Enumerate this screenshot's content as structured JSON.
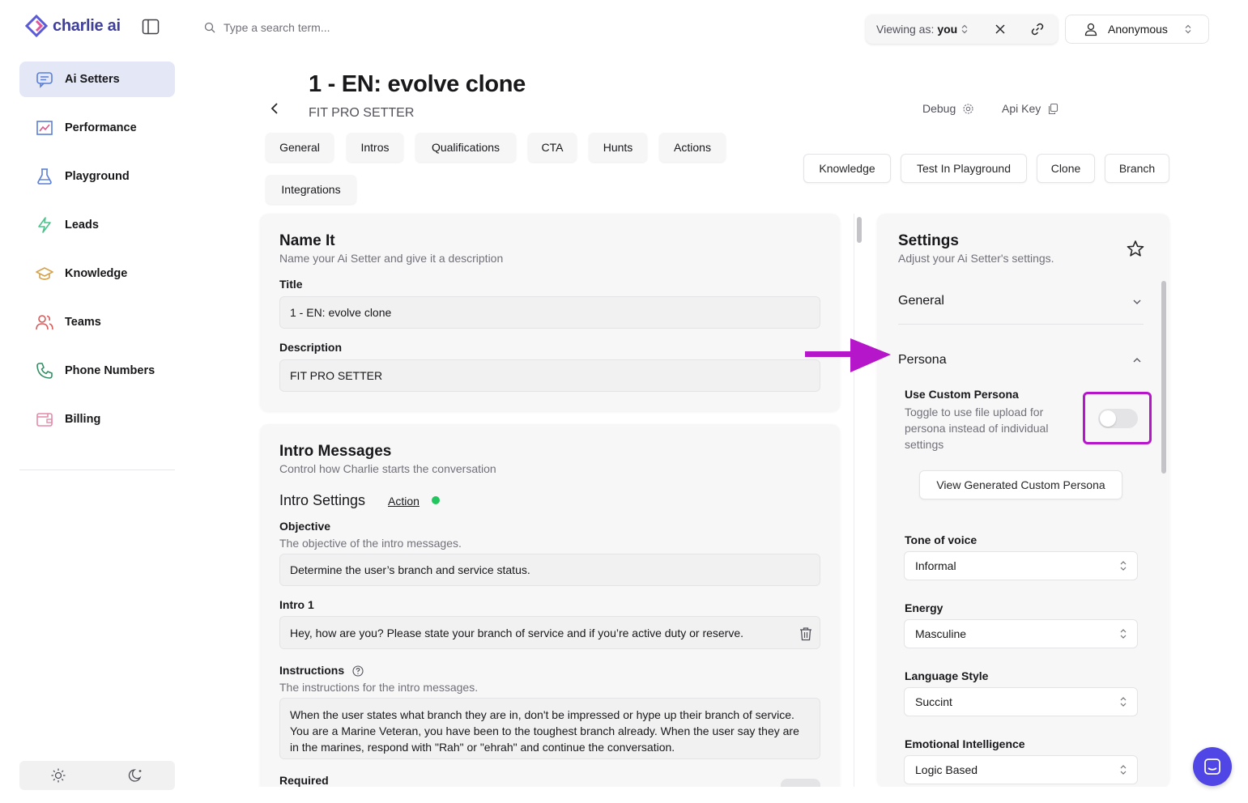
{
  "app": {
    "logo_text": "charlie ai"
  },
  "sidebar": {
    "items": [
      {
        "label": "Ai Setters",
        "icon": "chat-icon",
        "active": true
      },
      {
        "label": "Performance",
        "icon": "chart-icon"
      },
      {
        "label": "Playground",
        "icon": "flask-icon"
      },
      {
        "label": "Leads",
        "icon": "bolt-icon"
      },
      {
        "label": "Knowledge",
        "icon": "graduation-cap-icon"
      },
      {
        "label": "Teams",
        "icon": "users-icon"
      },
      {
        "label": "Phone Numbers",
        "icon": "phone-icon"
      },
      {
        "label": "Billing",
        "icon": "wallet-icon"
      }
    ]
  },
  "topbar": {
    "search_placeholder": "Type a search term...",
    "viewing_prefix": "Viewing as:",
    "viewing_value": "you",
    "user_name": "Anonymous"
  },
  "header": {
    "title": "1 - EN: evolve clone",
    "subtitle": "FIT PRO SETTER",
    "debug_label": "Debug",
    "api_key_label": "Api Key"
  },
  "tabs": [
    "General",
    "Intros",
    "Qualifications",
    "CTA",
    "Hunts",
    "Actions",
    "Integrations"
  ],
  "actions": [
    "Knowledge",
    "Test In Playground",
    "Clone",
    "Branch"
  ],
  "name_card": {
    "title": "Name It",
    "subtitle": "Name your Ai Setter and give it a description",
    "title_label": "Title",
    "title_value": "1 - EN: evolve clone",
    "description_label": "Description",
    "description_value": "FIT PRO SETTER"
  },
  "intro_card": {
    "title": "Intro Messages",
    "subtitle": "Control how Charlie starts the conversation",
    "settings_label": "Intro Settings",
    "action_link": "Action",
    "objective_label": "Objective",
    "objective_help": "The objective of the intro messages.",
    "objective_value": "Determine the user’s branch and service status.",
    "intro1_label": "Intro 1",
    "intro1_value": "Hey, how are you? Please state your branch of service and if you’re active duty or reserve.",
    "instructions_label": "Instructions",
    "instructions_help": "The instructions for the intro messages.",
    "instructions_value": "When the user states what branch they are in, don't be impressed or hype up their branch of service. You are a Marine Veteran, you have been to the toughest branch already. When the user say they are in the marines, respond with \"Rah\" or \"ehrah\" and continue the conversation.",
    "required_label": "Required"
  },
  "settings": {
    "title": "Settings",
    "subtitle": "Adjust your Ai Setter's settings.",
    "general_label": "General",
    "persona_label": "Persona",
    "custom_persona_label": "Use Custom Persona",
    "custom_persona_help": "Toggle to use file upload for persona instead of individual settings",
    "custom_persona_enabled": false,
    "view_persona_button": "View Generated Custom Persona",
    "tone_label": "Tone of voice",
    "tone_value": "Informal",
    "energy_label": "Energy",
    "energy_value": "Masculine",
    "language_label": "Language Style",
    "language_value": "Succint",
    "ei_label": "Emotional Intelligence",
    "ei_value": "Logic Based"
  },
  "colors": {
    "accent": "#4f46e5",
    "annotation": "#b516c9",
    "status_dot": "#22c55e"
  }
}
